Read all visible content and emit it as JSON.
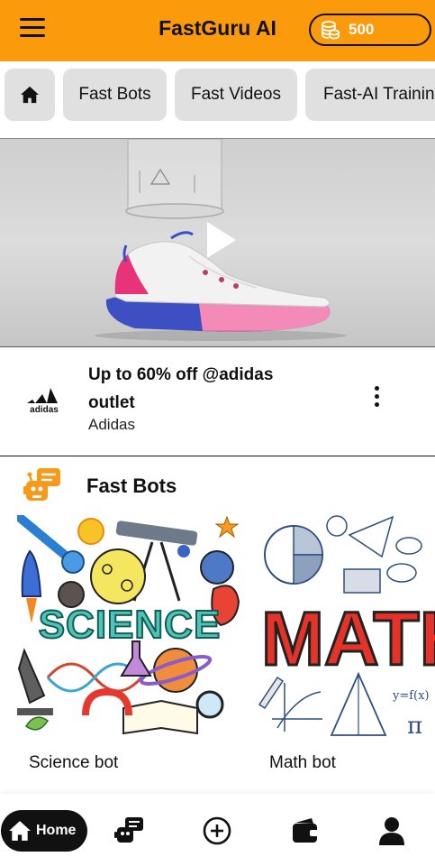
{
  "header": {
    "title": "FastGuru AI",
    "coins": "500",
    "menu_icon": "hamburger-menu-icon",
    "coin_icon": "coin-stack-icon"
  },
  "tabs": [
    {
      "icon": "home-icon",
      "label": ""
    },
    {
      "label": "Fast Bots"
    },
    {
      "label": "Fast Videos"
    },
    {
      "label": "Fast-AI Trainin"
    }
  ],
  "ad": {
    "title": "Up to 60% off @adidas outlet",
    "brand": "Adidas",
    "logo_text": "adidas"
  },
  "fast_bots": {
    "title": "Fast Bots",
    "cards": [
      {
        "label": "Science bot",
        "image_text": "SCIENCE"
      },
      {
        "label": "Math bot",
        "image_text": "MATH"
      }
    ]
  },
  "bottom_nav": {
    "home_label": "Home",
    "items": [
      "bots-icon",
      "add-circle-icon",
      "wallet-icon",
      "profile-icon"
    ]
  },
  "colors": {
    "brand_orange": "#fb9a0b",
    "tab_gray": "#e0e0e0",
    "dark": "#111111"
  }
}
